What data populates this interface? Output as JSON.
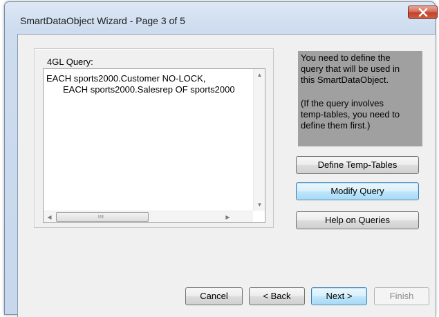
{
  "window": {
    "title": "SmartDataObject Wizard - Page 3 of 5",
    "close_icon": "close-x-icon"
  },
  "query": {
    "label": "4GL Query:",
    "lines": [
      "EACH sports2000.Customer NO-LOCK,",
      "EACH sports2000.Salesrep OF sports2000"
    ],
    "scroll_grip": "III"
  },
  "info": {
    "lines": [
      "You need to define the",
      "query that will be used in",
      "this SmartDataObject.",
      "",
      "(If the query involves",
      "temp-tables, you need to",
      "define them first.)"
    ]
  },
  "actions": {
    "define_temp_tables": "Define Temp-Tables",
    "modify_query": "Modify Query",
    "help_on_queries": "Help on Queries"
  },
  "footer": {
    "cancel": "Cancel",
    "back": "< Back",
    "next": "Next >",
    "finish": "Finish"
  },
  "colors": {
    "info_background": "#a0a0a0",
    "focus_accent": "#3c7fb1",
    "close_button": "#c1432c"
  }
}
